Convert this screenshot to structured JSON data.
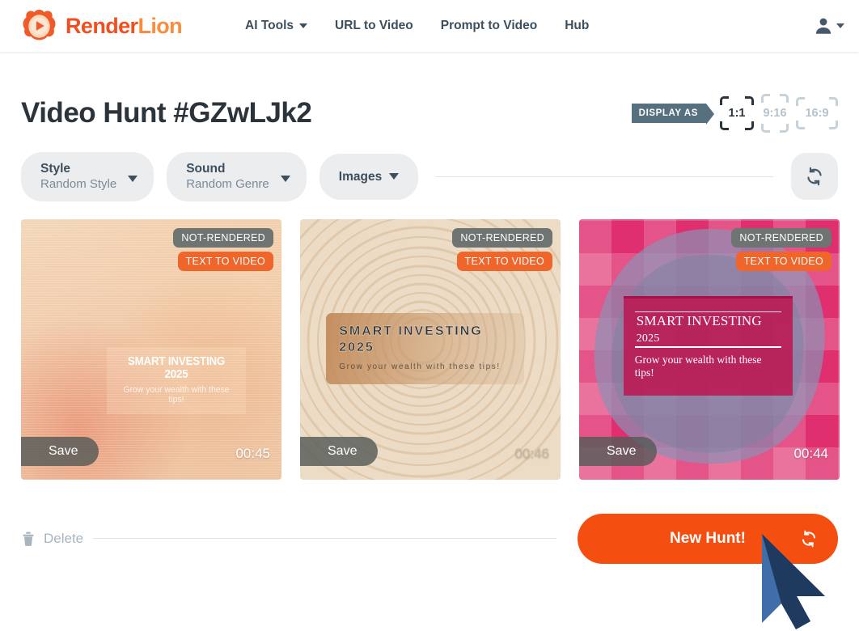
{
  "header": {
    "logo": {
      "icon": "lion-play-logo",
      "text_primary": "Render",
      "text_secondary": "Lion"
    },
    "nav": [
      {
        "label": "AI Tools",
        "has_caret": true
      },
      {
        "label": "URL to Video",
        "has_caret": false
      },
      {
        "label": "Prompt to Video",
        "has_caret": false
      },
      {
        "label": "Hub",
        "has_caret": false
      }
    ],
    "account": {
      "icon": "user-avatar-icon",
      "caret": "chevron-down-icon"
    }
  },
  "page": {
    "title": "Video Hunt #GZwLJk2",
    "display_as": {
      "label": "DISPLAY AS",
      "options": [
        {
          "label": "1:1",
          "active": true
        },
        {
          "label": "9:16",
          "active": false
        },
        {
          "label": "16:9",
          "active": false
        }
      ]
    },
    "filters": [
      {
        "label": "Style",
        "value": "Random Style",
        "icon": "chevron-down-icon"
      },
      {
        "label": "Sound",
        "value": "Random Genre",
        "icon": "chevron-down-icon"
      },
      {
        "label": "Images",
        "value": "",
        "icon": "chevron-down-icon"
      }
    ],
    "refresh": {
      "icon": "refresh-icon"
    }
  },
  "cards": [
    {
      "status_badge": "NOT-RENDERED",
      "type_badge": "TEXT TO VIDEO",
      "save_label": "Save",
      "duration": "00:45",
      "overlay_title": "SMART INVESTING 2025",
      "overlay_subtitle": "Grow your wealth with these tips!"
    },
    {
      "status_badge": "NOT-RENDERED",
      "type_badge": "TEXT TO VIDEO",
      "save_label": "Save",
      "duration": "00:46",
      "overlay_title": "SMART INVESTING 2025",
      "overlay_subtitle": "Grow your wealth with these tips!"
    },
    {
      "status_badge": "NOT-RENDERED",
      "type_badge": "TEXT TO VIDEO",
      "save_label": "Save",
      "duration": "00:44",
      "overlay_title": "SMART INVESTING",
      "overlay_year": "2025",
      "overlay_subtitle": "Grow your wealth with these tips!"
    }
  ],
  "footer": {
    "delete_label": "Delete",
    "delete_icon": "trash-icon",
    "new_hunt_label": "New Hunt!",
    "new_hunt_icon": "refresh-icon"
  },
  "colors": {
    "brand_orange": "#f24e1e",
    "brand_orange_light": "#fb8c3c",
    "cta_orange": "#f44e11",
    "badge_type": "#f0652a",
    "badge_status": "#6e7471",
    "slate": "#3d4f5c",
    "tag_slate": "#56707f",
    "muted": "#a8b4be",
    "pill_bg": "#ebedef",
    "cursor_dark": "#1f3a5f",
    "cursor_light": "#3f6ea8"
  },
  "cursor": {
    "icon": "mouse-pointer-cursor"
  }
}
